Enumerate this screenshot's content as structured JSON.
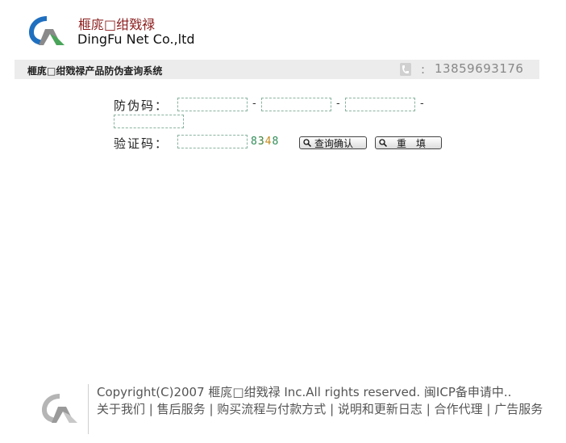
{
  "header": {
    "brand_cn": "榧庣□绀戣禄",
    "brand_en": "DingFu Net Co.,ltd"
  },
  "titlebar": {
    "title": "榧庣□绀戣禄产品防伪查询系统",
    "phone_colon": ":",
    "phone": "13859693176"
  },
  "form": {
    "code_label": "防伪码：",
    "code_values": [
      "",
      "",
      "",
      ""
    ],
    "dash": "-",
    "verify_label": "验证码：",
    "verify_value": "",
    "captcha": [
      "8",
      "3",
      "4",
      "8"
    ],
    "captcha_colors": [
      "#2e8b57",
      "#3a7d3a",
      "#c48a1c",
      "#2e8b57"
    ],
    "query_button": "查询确认",
    "reset_button": "重　填"
  },
  "footer": {
    "copyright": "Copyright(C)2007 榧庣□绀戣禄 Inc.All rights reserved. 闽ICP备申请中..",
    "links": [
      "关于我们",
      "售后服务",
      "购买流程与付款方式",
      "说明和更新日志",
      "合作代理",
      "广告服务"
    ],
    "separator": "|"
  }
}
